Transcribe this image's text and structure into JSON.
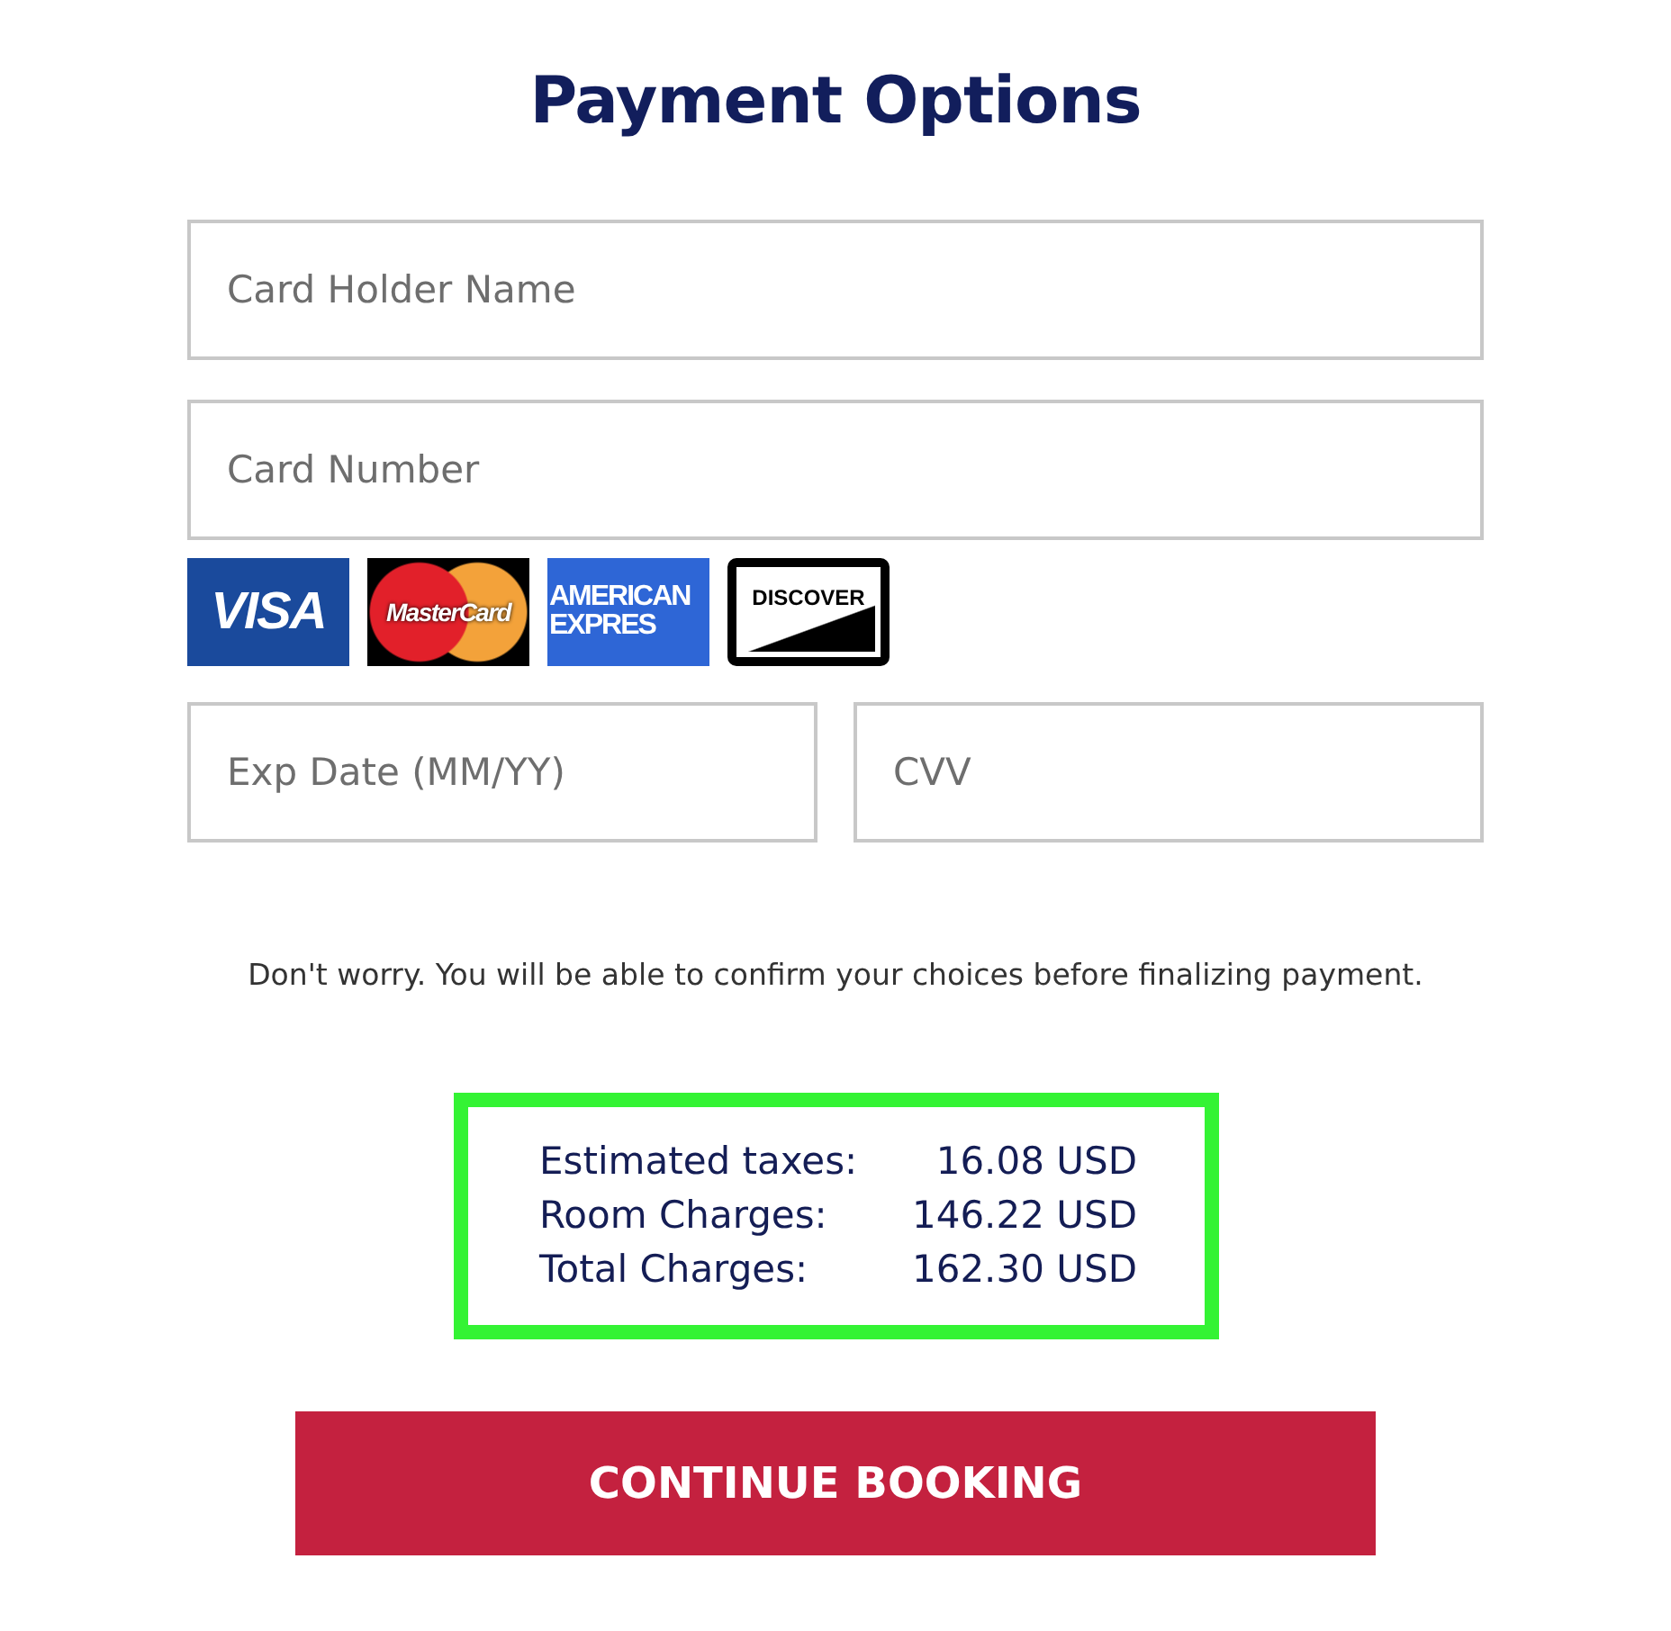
{
  "title": "Payment Options",
  "fields": [
    {
      "placeholder": "Card Holder Name"
    },
    {
      "placeholder": "Card Number"
    }
  ],
  "card_logos": [
    {
      "kind": "visa",
      "lines": [
        "VISA"
      ]
    },
    {
      "kind": "mastercard",
      "lines": [
        "MasterCard"
      ]
    },
    {
      "kind": "amex",
      "lines": [
        "AMERICAN",
        "EXPRES"
      ]
    },
    {
      "kind": "discover",
      "lines": [
        "DISCOVER"
      ]
    }
  ],
  "short_fields": [
    {
      "placeholder": "Exp Date (MM/YY)"
    },
    {
      "placeholder": "CVV"
    }
  ],
  "note": "Don't worry. You will be able to confirm your choices before finalizing payment.",
  "summary": [
    {
      "label": "Estimated taxes:",
      "value": "16.08 USD"
    },
    {
      "label": "Room Charges:",
      "value": "146.22 USD"
    },
    {
      "label": "Total Charges:",
      "value": "162.30 USD"
    }
  ],
  "button": "CONTINUE BOOKING"
}
